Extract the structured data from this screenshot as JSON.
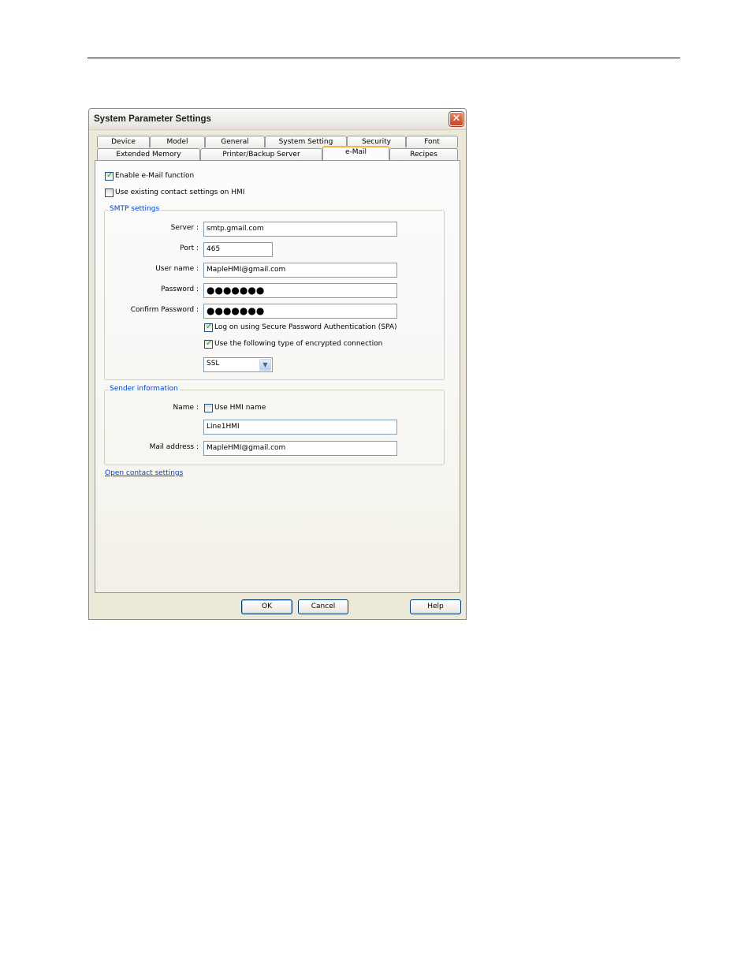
{
  "dialog": {
    "title": "System Parameter Settings",
    "close_symbol": "✕"
  },
  "tabs_row1": [
    {
      "label": "Device"
    },
    {
      "label": "Model"
    },
    {
      "label": "General"
    },
    {
      "label": "System Setting"
    },
    {
      "label": "Security"
    },
    {
      "label": "Font"
    }
  ],
  "tabs_row2": [
    {
      "label": "Extended Memory"
    },
    {
      "label": "Printer/Backup Server"
    },
    {
      "label": "e-Mail",
      "active": true
    },
    {
      "label": "Recipes"
    }
  ],
  "email": {
    "enable_label": "Enable e-Mail function",
    "enable_checked": true,
    "use_existing_label": "Use existing contact settings on HMI",
    "use_existing_checked": false
  },
  "smtp": {
    "legend": "SMTP settings",
    "server_label": "Server :",
    "server_value": "smtp.gmail.com",
    "port_label": "Port :",
    "port_value": "465",
    "user_label": "User name :",
    "user_value": "MapleHMI@gmail.com",
    "password_label": "Password :",
    "password_value": "●●●●●●●",
    "confirm_label": "Confirm Password :",
    "confirm_value": "●●●●●●●",
    "spa_label": "Log on using Secure Password Authentication (SPA)",
    "spa_checked": true,
    "encrypt_label": "Use the following type of encrypted connection",
    "encrypt_checked": true,
    "encryption_value": "SSL",
    "check_symbol": "✓",
    "dropdown_symbol": "▼"
  },
  "sender": {
    "legend": "Sender information",
    "name_label": "Name :",
    "use_hmi_name_label": "Use HMI name",
    "use_hmi_name_checked": false,
    "name_value": "Line1HMI",
    "mail_label": "Mail address :",
    "mail_value": "MapleHMI@gmail.com"
  },
  "links": {
    "open_contact": "Open contact settings"
  },
  "buttons": {
    "ok": "OK",
    "cancel": "Cancel",
    "help": "Help"
  }
}
